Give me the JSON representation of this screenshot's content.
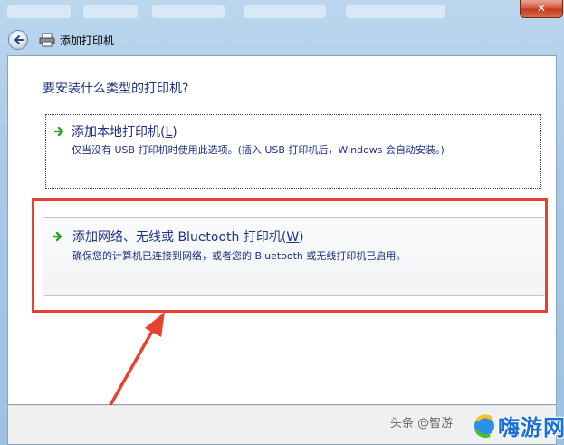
{
  "window": {
    "title": "添加打印机",
    "close_label": "✕"
  },
  "content": {
    "heading": "要安装什么类型的打印机?"
  },
  "options": [
    {
      "title_main": "添加本地打印机(",
      "hotkey": "L",
      "title_end": ")",
      "description": "仅当没有 USB 打印机时使用此选项。(插入 USB 打印机后，Windows 会自动安装。)"
    },
    {
      "title_main": "添加网络、无线或 Bluetooth 打印机(",
      "hotkey": "W",
      "title_end": ")",
      "description": "确保您的计算机已连接到网络，或者您的 Bluetooth 或无线打印机已启用。"
    }
  ],
  "watermark": {
    "text": "头条 @智游",
    "site_logo": "嗨游网"
  },
  "colors": {
    "link_blue": "#1e3287",
    "highlight_red": "#e8412f",
    "arrow_green": "#2aa52a"
  }
}
